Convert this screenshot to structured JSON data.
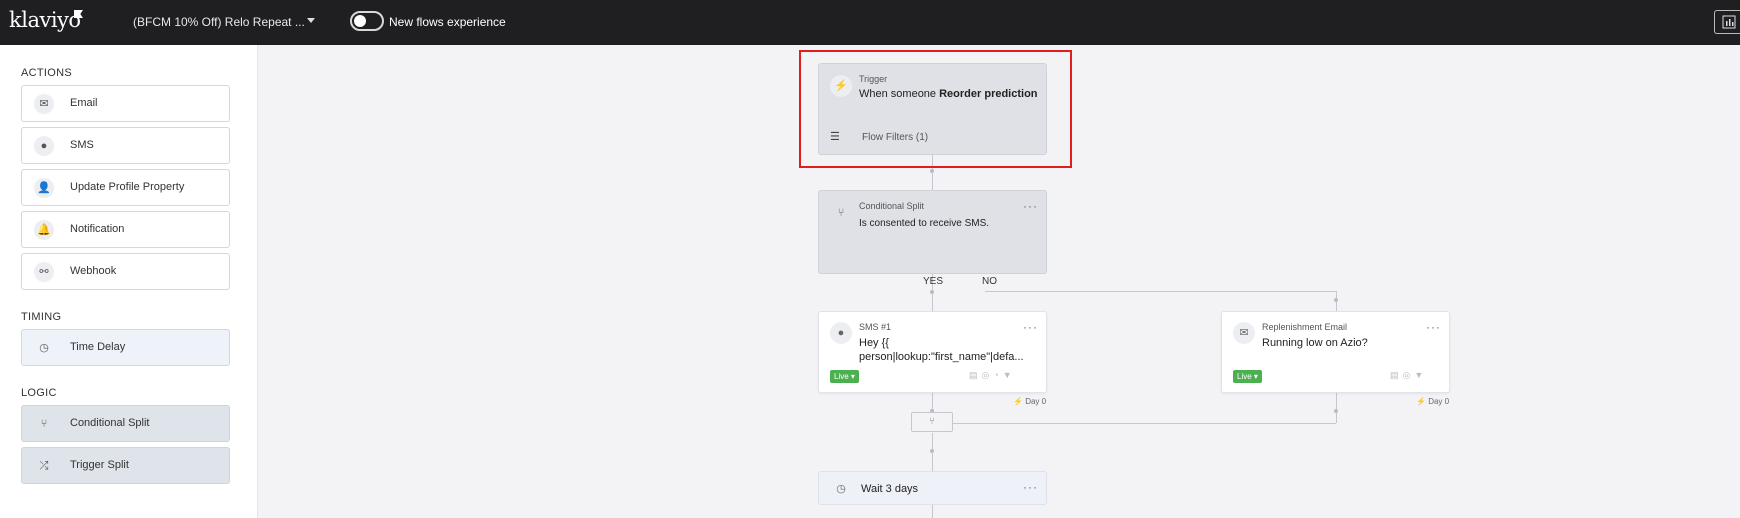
{
  "topbar": {
    "logo": "klaviyo",
    "flow_title": "(BFCM 10% Off) Relo Repeat ...",
    "toggle_label": "New flows experience"
  },
  "sidebar": {
    "actions_label": "ACTIONS",
    "actions": [
      {
        "label": "Email",
        "icon": "envelope-icon"
      },
      {
        "label": "SMS",
        "icon": "chat-icon"
      },
      {
        "label": "Update Profile Property",
        "icon": "person-icon"
      },
      {
        "label": "Notification",
        "icon": "bell-icon"
      },
      {
        "label": "Webhook",
        "icon": "webhook-icon"
      }
    ],
    "timing_label": "TIMING",
    "timing": [
      {
        "label": "Time Delay",
        "icon": "clock-icon"
      }
    ],
    "logic_label": "LOGIC",
    "logic": [
      {
        "label": "Conditional Split",
        "icon": "split-icon"
      },
      {
        "label": "Trigger Split",
        "icon": "trigger-split-icon"
      }
    ]
  },
  "canvas": {
    "trigger": {
      "type": "Trigger",
      "text_prefix": "When someone ",
      "text_bold": "Reorder prediction",
      "filters": "Flow Filters (1)"
    },
    "conditional_split": {
      "type": "Conditional Split",
      "text": "Is consented to receive SMS."
    },
    "yes_label": "YES",
    "no_label": "NO",
    "sms": {
      "type": "SMS #1",
      "line1": "Hey {{",
      "line2": "person|lookup:\"first_name\"|defa...",
      "status": "Live",
      "day": "Day 0"
    },
    "email": {
      "type": "Replenishment Email",
      "text": "Running low on Azio?",
      "status": "Live",
      "day": "Day 0"
    },
    "wait": {
      "text": "Wait 3 days"
    }
  },
  "colors": {
    "live": "#4caf50",
    "highlight": "#e01e1e",
    "topbar": "#1f1f22"
  }
}
